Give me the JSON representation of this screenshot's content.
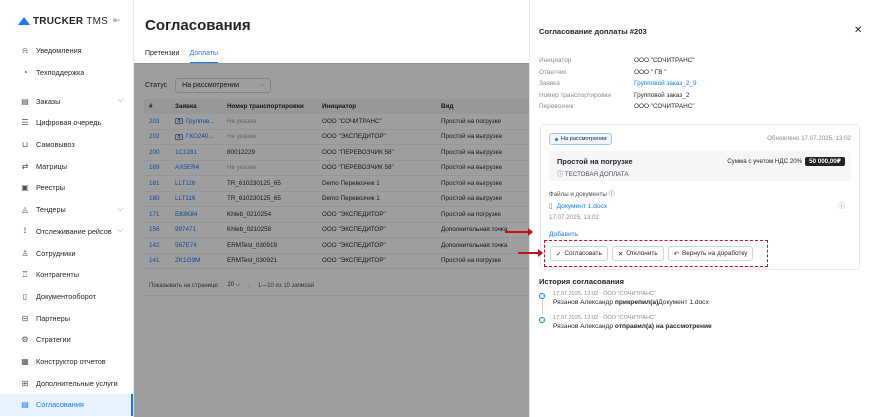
{
  "sidebar": {
    "logo_brand": "TRUCKER",
    "logo_suffix": "TMS",
    "items": [
      {
        "label": "Уведомления",
        "icon": "bell-icon",
        "glyph": "⍾"
      },
      {
        "label": "Техподдержка",
        "icon": "support-icon",
        "glyph": "◔"
      },
      {
        "label": "Заказы",
        "icon": "orders-icon",
        "glyph": "▤",
        "chevron": true
      },
      {
        "label": "Цифровая очередь",
        "icon": "queue-icon",
        "glyph": "☰"
      },
      {
        "label": "Самовывоз",
        "icon": "pickup-icon",
        "glyph": "⊔"
      },
      {
        "label": "Матрицы",
        "icon": "matrix-icon",
        "glyph": "⇄"
      },
      {
        "label": "Реестры",
        "icon": "registry-icon",
        "glyph": "▣"
      },
      {
        "label": "Тендеры",
        "icon": "tenders-icon",
        "glyph": "◬",
        "chevron": true
      },
      {
        "label": "Отслеживание рейсов",
        "icon": "tracking-icon",
        "glyph": "⟟",
        "chevron": true
      },
      {
        "label": "Сотрудники",
        "icon": "employees-icon",
        "glyph": "♙"
      },
      {
        "label": "Контрагенты",
        "icon": "contractors-icon",
        "glyph": "♖"
      },
      {
        "label": "Документооборот",
        "icon": "documents-icon",
        "glyph": "▯"
      },
      {
        "label": "Партнеры",
        "icon": "partners-icon",
        "glyph": "⊟"
      },
      {
        "label": "Стратегии",
        "icon": "strategies-icon",
        "glyph": "⚙"
      },
      {
        "label": "Конструктор отчетов",
        "icon": "reports-icon",
        "glyph": "▦"
      },
      {
        "label": "Дополнительные услуги",
        "icon": "services-icon",
        "glyph": "⊞"
      },
      {
        "label": "Согласования",
        "icon": "approvals-icon",
        "glyph": "▤"
      }
    ]
  },
  "main": {
    "title": "Согласования",
    "tabs": [
      "Претензии",
      "Доплаты"
    ],
    "filter_label": "Статус",
    "filter_value": "На рассмотрении",
    "columns": [
      "#",
      "Заявка",
      "Номер транспортировки",
      "Инициатор",
      "Вид"
    ],
    "rows": [
      [
        "203",
        "Группов...",
        "Не указан",
        "ООО \"СОЧИТРАНС\"",
        "Простой на погрузке"
      ],
      [
        "202",
        "ГКО240...",
        "Не указан",
        "ООО \"ЭКСПЕДИТОР\"",
        "Простой на выгрузке"
      ],
      [
        "200",
        "1С1281",
        "80012229",
        "ООО \"ПЕРЕВОЗЧИК 58\"",
        "Простой на выгрузке"
      ],
      [
        "189",
        "AX5ER4",
        "Не указан",
        "ООО \"ПЕРЕВОЗЧИК 58\"",
        "Простой на выгрузке"
      ],
      [
        "181",
        "LLT116",
        "TR_610230125_65",
        "Demo Перевозчик 1",
        "Простой на выгрузке"
      ],
      [
        "180",
        "LLT116",
        "TR_610230125_65",
        "Demo Перевозчик 1",
        "Простой на выгрузке"
      ],
      [
        "171",
        "E83K84",
        "Khleb_0210254",
        "ООО \"ЭКСПЕДИТОР\"",
        "Простой на погрузке"
      ],
      [
        "156",
        "997471",
        "Khleb_0210258",
        "ООО \"ЭКСПЕДИТОР\"",
        "Дополнительная точка"
      ],
      [
        "142",
        "567E74",
        "ERMTest_030919",
        "ООО \"ЭКСПЕДИТОР\"",
        "Дополнительная точка"
      ],
      [
        "141",
        "ZK1G9M",
        "ERMTest_030921",
        "ООО \"ЭКСПЕДИТОР\"",
        "Простой на погрузке"
      ]
    ],
    "pager_label": "Показывать на странице:",
    "pager_size": "20",
    "pager_range": "1—10 из 10 записей"
  },
  "drawer": {
    "title": "Согласование доплаты #203",
    "info": [
      {
        "key": "Инициатор",
        "value": "ООО \"СОЧИТРАНС\""
      },
      {
        "key": "Ответчик",
        "value": "ООО \" ГВ \""
      },
      {
        "key": "Заявка",
        "value": "Групповой заказ_2_9",
        "link": true
      },
      {
        "key": "Номер транспортировки",
        "value": "Групповой заказ_2"
      },
      {
        "key": "Перевозчик",
        "value": "ООО \"СОЧИТРАНС\""
      }
    ],
    "status_badge": "На рассмотрении",
    "updated": "Обновлено 17.07.2025, 13:02",
    "charge_name": "Простой на погрузке",
    "charge_sub": "ТЕСТОВАЯ ДОПЛАТА",
    "sum_label": "Сумма с учетом НДС 20%",
    "sum_value": "50 000,00₽",
    "files_label": "Файлы и документы",
    "doc_name": "Документ 1.docx",
    "doc_date": "17.07.2025, 13:02",
    "add_label": "Добавить",
    "btn_approve": "Согласовать",
    "btn_reject": "Отклонить",
    "btn_return": "Вернуть на доработку",
    "history_title": "История согласования",
    "history": [
      {
        "meta": "17.07.2025, 13:02 · ООО \"СОЧИТРАНС\"",
        "name": "Рязанов Александр",
        "action": "прикрепил(а)",
        "tail": "Документ 1.docx"
      },
      {
        "meta": "17.07.2025, 13:02 · ООО \"СОЧИТРАНС\"",
        "name": "Рязанов Александр",
        "action": "отправил(а) на рассмотрение",
        "tail": ""
      }
    ]
  },
  "colors": {
    "accent": "#1677ff",
    "annotation": "#c1121f"
  }
}
